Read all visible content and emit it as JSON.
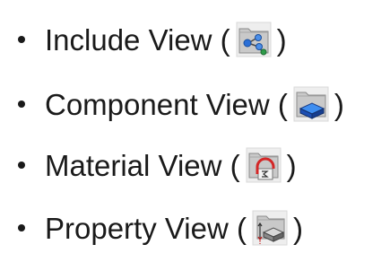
{
  "items": [
    {
      "label": "Include View (",
      "close": ")",
      "icon": "include-view-icon"
    },
    {
      "label": "Component View (",
      "close": ")",
      "icon": "component-view-icon"
    },
    {
      "label": "Material View (",
      "close": ")",
      "icon": "material-view-icon"
    },
    {
      "label": "Property View (",
      "close": ")",
      "icon": "property-view-icon"
    }
  ]
}
